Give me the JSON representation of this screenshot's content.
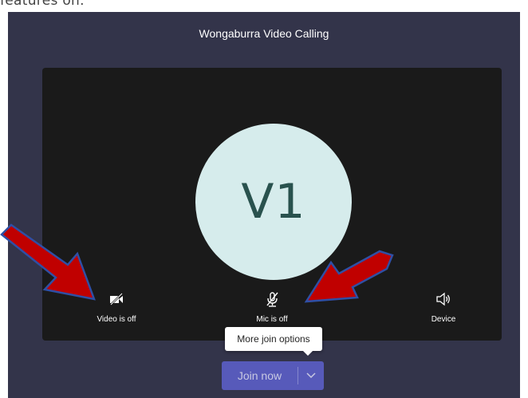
{
  "caption": "features on.",
  "window": {
    "title": "Wongaburra Video Calling"
  },
  "avatar": {
    "initials": "V1",
    "bg_color": "#d6ecec",
    "text_color": "#29524e"
  },
  "controls": {
    "video": {
      "label": "Video is off",
      "icon": "video-off-icon"
    },
    "mic": {
      "label": "Mic is off",
      "icon": "mic-off-icon"
    },
    "device": {
      "label": "Device",
      "icon": "speaker-icon"
    }
  },
  "tooltip": {
    "text": "More join options"
  },
  "join": {
    "label": "Join now",
    "dropdown_icon": "chevron-down-icon",
    "color": "#5b5fc7"
  },
  "annotations": {
    "arrow_color": "#c00000",
    "arrow_outline": "#2f4fa5",
    "arrow_icon": "red-arrow-icon"
  },
  "colors": {
    "background": "#33344a",
    "stage": "#1a1a1a"
  }
}
